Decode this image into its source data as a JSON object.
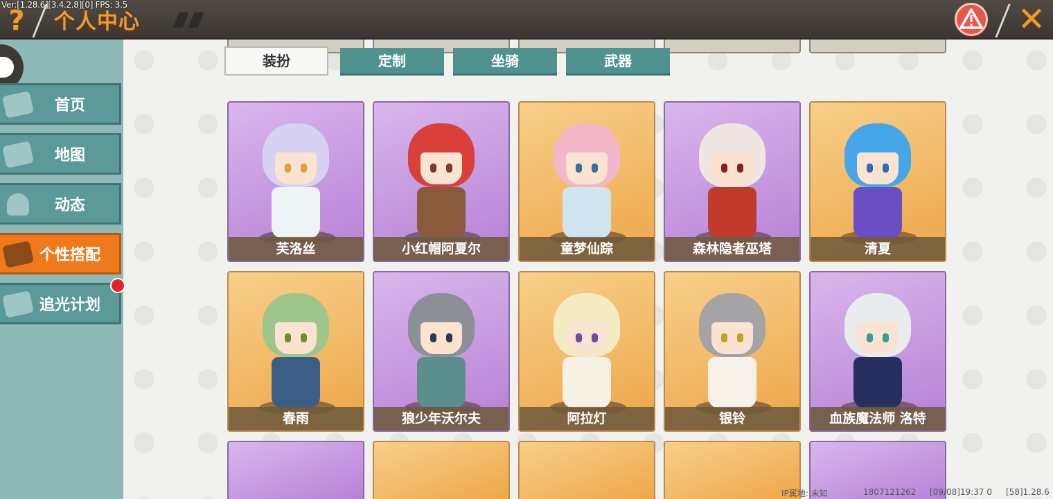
{
  "debug": {
    "version": "Ver:[1.28.6][3.4.2.8][0] FPS: 3.5"
  },
  "header": {
    "title": "个人中心",
    "help_icon": "question-mark-icon",
    "warn_icon": "warning-icon",
    "close_icon": "close-x-icon"
  },
  "sidebar": {
    "items": [
      {
        "label": "首页",
        "icon": "home-icon"
      },
      {
        "label": "地图",
        "icon": "map-icon"
      },
      {
        "label": "动态",
        "icon": "bell-icon"
      },
      {
        "label": "个性搭配",
        "icon": "outfit-icon",
        "active": true
      },
      {
        "label": "追光计划",
        "icon": "plan-icon"
      }
    ]
  },
  "tabs": [
    {
      "label": "装扮",
      "active": true
    },
    {
      "label": "定制"
    },
    {
      "label": "坐骑"
    },
    {
      "label": "武器"
    }
  ],
  "cards": [
    {
      "name": "芙洛丝",
      "bg": "purple",
      "hair": "#d8d2f2",
      "outfit": "#eef3f4",
      "eye": "#d8a33b"
    },
    {
      "name": "小红帽阿夏尔",
      "bg": "purple",
      "hair": "#d9403a",
      "outfit": "#8a5a3c",
      "eye": "#7b3a32"
    },
    {
      "name": "童梦仙踪",
      "bg": "orange",
      "hair": "#f3b7c9",
      "outfit": "#cfe4ef",
      "eye": "#3c6e9a"
    },
    {
      "name": "森林隐者巫塔",
      "bg": "purple",
      "hair": "#efe7df",
      "outfit": "#c23a2a",
      "eye": "#8b1f1f"
    },
    {
      "name": "清夏",
      "bg": "orange",
      "hair": "#46a6e8",
      "outfit": "#6a4fc4",
      "eye": "#2f6fb0"
    },
    {
      "name": "春雨",
      "bg": "orange",
      "hair": "#9dc58c",
      "outfit": "#3c5e86",
      "eye": "#6b8e2a"
    },
    {
      "name": "狼少年沃尔夫",
      "bg": "purple",
      "hair": "#8c8f96",
      "outfit": "#5c8f8c",
      "eye": "#2c3a4d"
    },
    {
      "name": "阿拉灯",
      "bg": "orange",
      "hair": "#f3ecc2",
      "outfit": "#f5f1e4",
      "eye": "#6e4aa3"
    },
    {
      "name": "银铃",
      "bg": "orange",
      "hair": "#a4a3a6",
      "outfit": "#f6f2ea",
      "eye": "#c9a11f"
    },
    {
      "name": "血族魔法师 洛特",
      "bg": "purple",
      "hair": "#e9ecec",
      "outfit": "#26305e",
      "eye": "#2f9f98"
    }
  ],
  "bottom_row_bg": [
    "purple",
    "orange",
    "orange",
    "orange",
    "purple"
  ],
  "footer": {
    "ip": "IP属地: 未知",
    "uid": "1807121262",
    "time": "[09/08]19:37 0",
    "build": "[58]1.28.6"
  }
}
